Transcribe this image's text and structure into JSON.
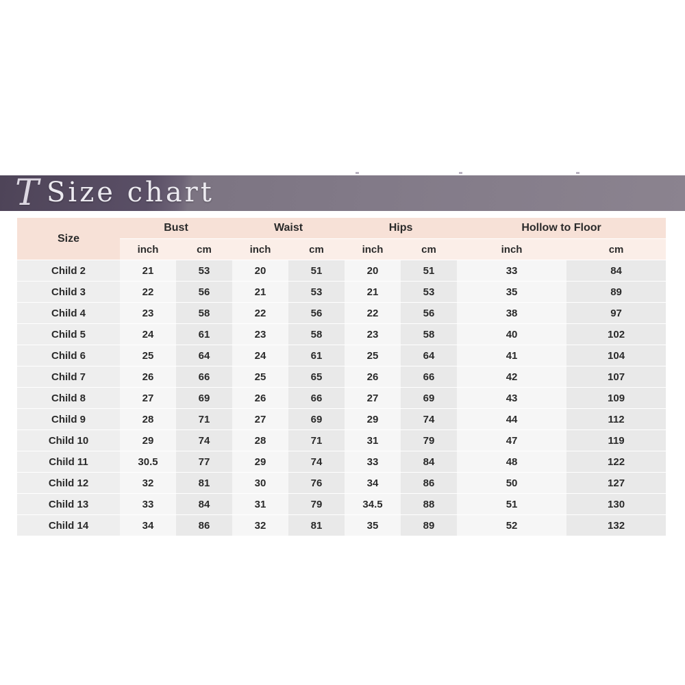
{
  "banner": {
    "flourish": "T",
    "title": "Size chart"
  },
  "table": {
    "size_header": "Size",
    "groups": [
      "Bust",
      "Waist",
      "Hips",
      "Hollow to Floor"
    ],
    "units": [
      "inch",
      "cm",
      "inch",
      "cm",
      "inch",
      "cm",
      "inch",
      "cm"
    ],
    "rows": [
      {
        "size": "Child 2",
        "bust_inch": "21",
        "bust_cm": "53",
        "waist_inch": "20",
        "waist_cm": "51",
        "hips_inch": "20",
        "hips_cm": "51",
        "hollow_inch": "33",
        "hollow_cm": "84"
      },
      {
        "size": "Child 3",
        "bust_inch": "22",
        "bust_cm": "56",
        "waist_inch": "21",
        "waist_cm": "53",
        "hips_inch": "21",
        "hips_cm": "53",
        "hollow_inch": "35",
        "hollow_cm": "89"
      },
      {
        "size": "Child 4",
        "bust_inch": "23",
        "bust_cm": "58",
        "waist_inch": "22",
        "waist_cm": "56",
        "hips_inch": "22",
        "hips_cm": "56",
        "hollow_inch": "38",
        "hollow_cm": "97"
      },
      {
        "size": "Child 5",
        "bust_inch": "24",
        "bust_cm": "61",
        "waist_inch": "23",
        "waist_cm": "58",
        "hips_inch": "23",
        "hips_cm": "58",
        "hollow_inch": "40",
        "hollow_cm": "102"
      },
      {
        "size": "Child 6",
        "bust_inch": "25",
        "bust_cm": "64",
        "waist_inch": "24",
        "waist_cm": "61",
        "hips_inch": "25",
        "hips_cm": "64",
        "hollow_inch": "41",
        "hollow_cm": "104"
      },
      {
        "size": "Child 7",
        "bust_inch": "26",
        "bust_cm": "66",
        "waist_inch": "25",
        "waist_cm": "65",
        "hips_inch": "26",
        "hips_cm": "66",
        "hollow_inch": "42",
        "hollow_cm": "107"
      },
      {
        "size": "Child 8",
        "bust_inch": "27",
        "bust_cm": "69",
        "waist_inch": "26",
        "waist_cm": "66",
        "hips_inch": "27",
        "hips_cm": "69",
        "hollow_inch": "43",
        "hollow_cm": "109"
      },
      {
        "size": "Child 9",
        "bust_inch": "28",
        "bust_cm": "71",
        "waist_inch": "27",
        "waist_cm": "69",
        "hips_inch": "29",
        "hips_cm": "74",
        "hollow_inch": "44",
        "hollow_cm": "112"
      },
      {
        "size": "Child 10",
        "bust_inch": "29",
        "bust_cm": "74",
        "waist_inch": "28",
        "waist_cm": "71",
        "hips_inch": "31",
        "hips_cm": "79",
        "hollow_inch": "47",
        "hollow_cm": "119"
      },
      {
        "size": "Child 11",
        "bust_inch": "30.5",
        "bust_cm": "77",
        "waist_inch": "29",
        "waist_cm": "74",
        "hips_inch": "33",
        "hips_cm": "84",
        "hollow_inch": "48",
        "hollow_cm": "122"
      },
      {
        "size": "Child 12",
        "bust_inch": "32",
        "bust_cm": "81",
        "waist_inch": "30",
        "waist_cm": "76",
        "hips_inch": "34",
        "hips_cm": "86",
        "hollow_inch": "50",
        "hollow_cm": "127"
      },
      {
        "size": "Child 13",
        "bust_inch": "33",
        "bust_cm": "84",
        "waist_inch": "31",
        "waist_cm": "79",
        "hips_inch": "34.5",
        "hips_cm": "88",
        "hollow_inch": "51",
        "hollow_cm": "130"
      },
      {
        "size": "Child 14",
        "bust_inch": "34",
        "bust_cm": "86",
        "waist_inch": "32",
        "waist_cm": "81",
        "hips_inch": "35",
        "hips_cm": "89",
        "hollow_inch": "52",
        "hollow_cm": "132"
      }
    ]
  },
  "colors": {
    "banner_dark": "#4e4458",
    "banner_light": "#8b838f",
    "header_peach": "#f7e1d7",
    "header_peach_light": "#fbeee8",
    "row_light": "#f6f6f6",
    "row_dark": "#e9e9e9",
    "size_cell": "#eeeeee"
  }
}
